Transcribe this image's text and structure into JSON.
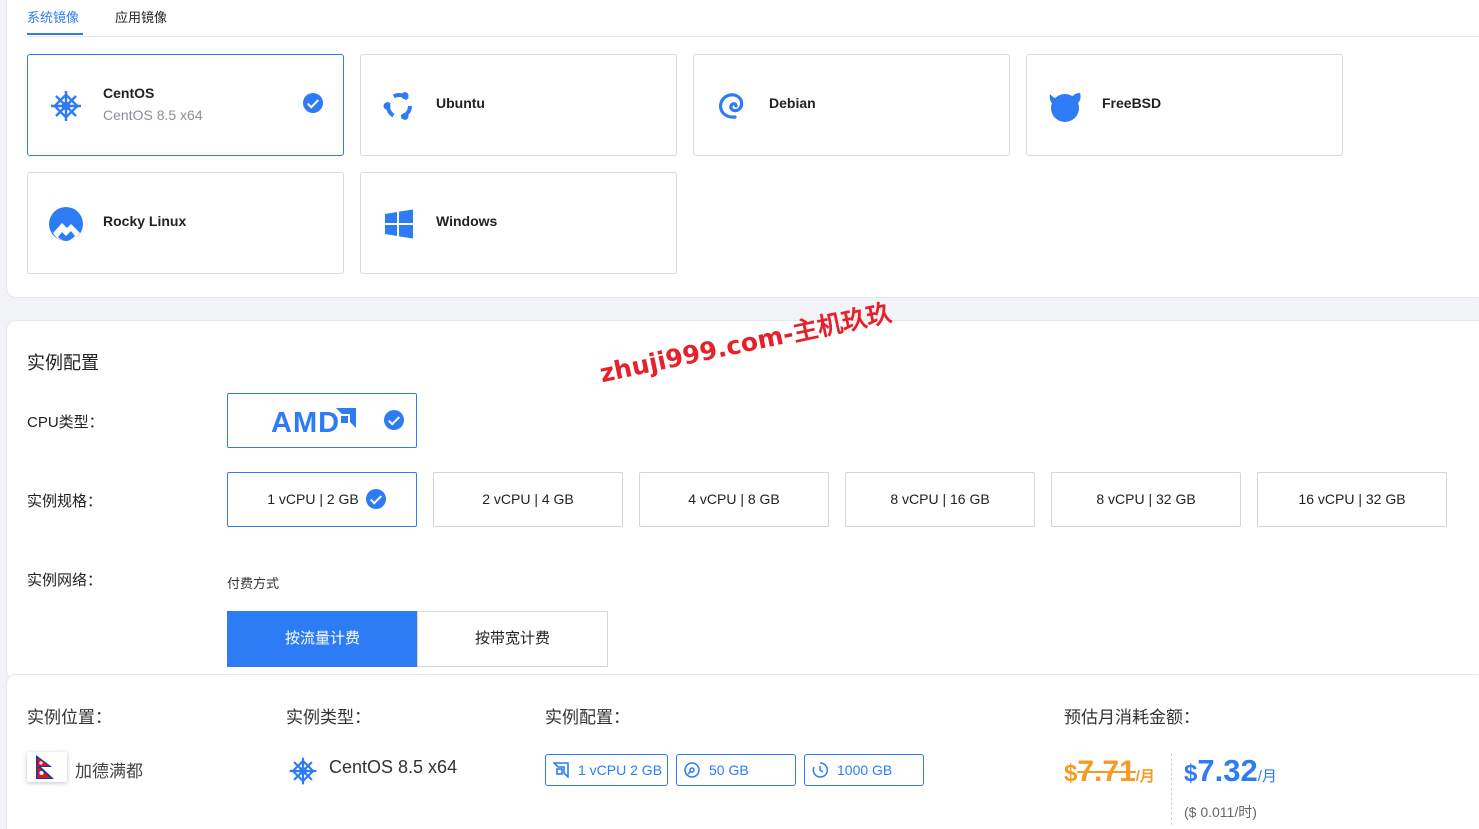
{
  "tabs": [
    {
      "label": "系统镜像",
      "active": true
    },
    {
      "label": "应用镜像",
      "active": false
    }
  ],
  "os_images": [
    {
      "name": "CentOS",
      "version": "CentOS 8.5 x64",
      "selected": true,
      "icon": "centos-icon"
    },
    {
      "name": "Ubuntu",
      "selected": false,
      "icon": "ubuntu-icon"
    },
    {
      "name": "Debian",
      "selected": false,
      "icon": "debian-icon"
    },
    {
      "name": "FreeBSD",
      "selected": false,
      "icon": "freebsd-icon"
    },
    {
      "name": "Rocky Linux",
      "selected": false,
      "icon": "rocky-linux-icon"
    },
    {
      "name": "Windows",
      "selected": false,
      "icon": "windows-icon"
    }
  ],
  "config": {
    "title": "实例配置",
    "cpu_label": "CPU类型：",
    "cpu_option": "AMD",
    "spec_label": "实例规格：",
    "specs": [
      {
        "label": "1 vCPU | 2 GB",
        "selected": true
      },
      {
        "label": "2 vCPU | 4 GB",
        "selected": false
      },
      {
        "label": "4 vCPU | 8 GB",
        "selected": false
      },
      {
        "label": "8 vCPU | 16 GB",
        "selected": false
      },
      {
        "label": "8 vCPU | 32 GB",
        "selected": false
      },
      {
        "label": "16 vCPU | 32 GB",
        "selected": false
      }
    ],
    "network_label": "实例网络：",
    "payment_caption": "付费方式",
    "payment_options": [
      {
        "label": "按流量计费",
        "active": true
      },
      {
        "label": "按带宽计费",
        "active": false
      }
    ]
  },
  "watermark": "zhuji999.com-主机玖玖",
  "summary": {
    "location_label": "实例位置：",
    "location": "加德满都",
    "type_label": "实例类型：",
    "type": "CentOS 8.5 x64",
    "config_label": "实例配置：",
    "badges": [
      {
        "text": "1 vCPU 2 GB",
        "icon": "cpu-icon"
      },
      {
        "text": "50 GB",
        "icon": "disk-icon"
      },
      {
        "text": "1000 GB",
        "icon": "traffic-icon"
      }
    ],
    "price_label": "预估月消耗金额：",
    "old_currency": "$",
    "old_price": "7.71",
    "old_per": "/月",
    "new_currency": "$",
    "new_price": "7.32",
    "new_per": "/月",
    "hourly": "($ 0.011/时)"
  },
  "colors": {
    "accent": "#2d7cf6",
    "old_price": "#f59a23",
    "watermark": "#e6212a"
  }
}
